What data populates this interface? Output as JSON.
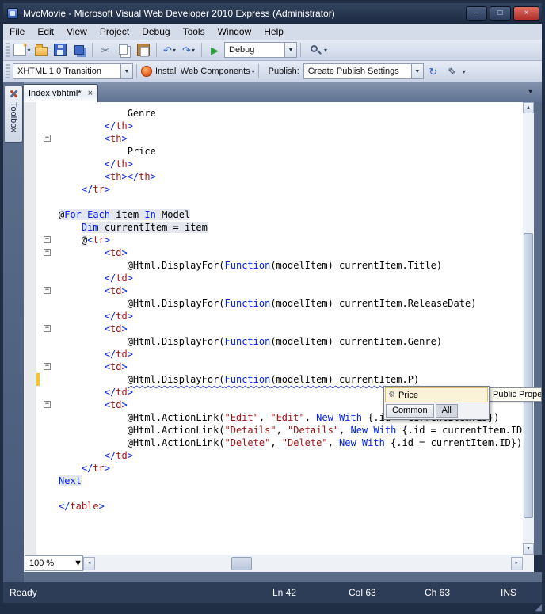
{
  "window": {
    "title": "MvcMovie - Microsoft Visual Web Developer 2010 Express (Administrator)"
  },
  "icons": {
    "minimize": "–",
    "maximize": "□",
    "close": "×",
    "dropdown": "▾",
    "combo_arrow": "▼",
    "cut": "✂",
    "undo": "↶",
    "redo": "↷",
    "play": "▶",
    "refresh": "↻",
    "pencil": "✎",
    "tab_close": "×",
    "tablist": "▼",
    "up": "▲",
    "down": "▼",
    "left": "◄",
    "right": "►",
    "property": "⚙",
    "grip": "◢",
    "fold_collapse": "−"
  },
  "menu": {
    "items": [
      "File",
      "Edit",
      "View",
      "Project",
      "Debug",
      "Tools",
      "Window",
      "Help"
    ]
  },
  "toolbar1": {
    "debug_combo": "Debug"
  },
  "toolbar2": {
    "schema_combo": "XHTML 1.0 Transition",
    "install_label": "Install Web Components",
    "publish_label": "Publish:",
    "publish_combo": "Create Publish Settings"
  },
  "tabs": {
    "active": "Index.vbhtml*"
  },
  "toolbox": {
    "label": "Toolbox"
  },
  "editor": {
    "fold_lines": [
      3,
      11,
      12,
      15,
      18,
      21,
      24
    ],
    "changed_lines": [
      22
    ],
    "lines": [
      [
        {
          "t": "            Genre"
        }
      ],
      [
        {
          "t": "        "
        },
        {
          "t": "</",
          "c": "k"
        },
        {
          "t": "th",
          "c": "m"
        },
        {
          "t": ">",
          "c": "k"
        }
      ],
      [
        {
          "t": "        "
        },
        {
          "t": "<",
          "c": "k"
        },
        {
          "t": "th",
          "c": "m"
        },
        {
          "t": ">",
          "c": "k"
        }
      ],
      [
        {
          "t": "            Price"
        }
      ],
      [
        {
          "t": "        "
        },
        {
          "t": "</",
          "c": "k"
        },
        {
          "t": "th",
          "c": "m"
        },
        {
          "t": ">",
          "c": "k"
        }
      ],
      [
        {
          "t": "        "
        },
        {
          "t": "<",
          "c": "k"
        },
        {
          "t": "th",
          "c": "m"
        },
        {
          "t": ">",
          "c": "k"
        },
        {
          "t": "</",
          "c": "k"
        },
        {
          "t": "th",
          "c": "m"
        },
        {
          "t": ">",
          "c": "k"
        }
      ],
      [
        {
          "t": "    "
        },
        {
          "t": "</",
          "c": "k"
        },
        {
          "t": "tr",
          "c": "m"
        },
        {
          "t": ">",
          "c": "k"
        }
      ],
      [],
      [
        {
          "t": "@",
          "bg": 1
        },
        {
          "t": "For Each",
          "c": "k",
          "bg": 1
        },
        {
          "t": " item ",
          "bg": 1
        },
        {
          "t": "In",
          "c": "k",
          "bg": 1
        },
        {
          "t": " Model",
          "bg": 1
        }
      ],
      [
        {
          "t": "    "
        },
        {
          "t": "Dim",
          "c": "k",
          "bg": 1
        },
        {
          "t": " currentItem = item",
          "bg": 1
        }
      ],
      [
        {
          "t": "    "
        },
        {
          "t": "@",
          "bg": 1
        },
        {
          "t": "<",
          "c": "k"
        },
        {
          "t": "tr",
          "c": "m"
        },
        {
          "t": ">",
          "c": "k"
        }
      ],
      [
        {
          "t": "        "
        },
        {
          "t": "<",
          "c": "k"
        },
        {
          "t": "td",
          "c": "m"
        },
        {
          "t": ">",
          "c": "k"
        }
      ],
      [
        {
          "t": "            "
        },
        {
          "t": "@Html.DisplayFor("
        },
        {
          "t": "Function",
          "c": "k"
        },
        {
          "t": "(modelItem) currentItem.Title)"
        }
      ],
      [
        {
          "t": "        "
        },
        {
          "t": "</",
          "c": "k"
        },
        {
          "t": "td",
          "c": "m"
        },
        {
          "t": ">",
          "c": "k"
        }
      ],
      [
        {
          "t": "        "
        },
        {
          "t": "<",
          "c": "k"
        },
        {
          "t": "td",
          "c": "m"
        },
        {
          "t": ">",
          "c": "k"
        }
      ],
      [
        {
          "t": "            "
        },
        {
          "t": "@Html.DisplayFor("
        },
        {
          "t": "Function",
          "c": "k"
        },
        {
          "t": "(modelItem) currentItem.ReleaseDate)"
        }
      ],
      [
        {
          "t": "        "
        },
        {
          "t": "</",
          "c": "k"
        },
        {
          "t": "td",
          "c": "m"
        },
        {
          "t": ">",
          "c": "k"
        }
      ],
      [
        {
          "t": "        "
        },
        {
          "t": "<",
          "c": "k"
        },
        {
          "t": "td",
          "c": "m"
        },
        {
          "t": ">",
          "c": "k"
        }
      ],
      [
        {
          "t": "            "
        },
        {
          "t": "@Html.DisplayFor("
        },
        {
          "t": "Function",
          "c": "k"
        },
        {
          "t": "(modelItem) currentItem.Genre)"
        }
      ],
      [
        {
          "t": "        "
        },
        {
          "t": "</",
          "c": "k"
        },
        {
          "t": "td",
          "c": "m"
        },
        {
          "t": ">",
          "c": "k"
        }
      ],
      [
        {
          "t": "        "
        },
        {
          "t": "<",
          "c": "k"
        },
        {
          "t": "td",
          "c": "m"
        },
        {
          "t": ">",
          "c": "k"
        }
      ],
      [
        {
          "t": "            "
        },
        {
          "t": "@Html.DisplayFor(",
          "sq": 1
        },
        {
          "t": "Function",
          "c": "k",
          "sq": 1
        },
        {
          "t": "(modelItem) currentItem.P)",
          "sq": 1
        }
      ],
      [
        {
          "t": "        "
        },
        {
          "t": "</",
          "c": "k"
        },
        {
          "t": "td",
          "c": "m"
        },
        {
          "t": ">",
          "c": "k"
        }
      ],
      [
        {
          "t": "        "
        },
        {
          "t": "<",
          "c": "k"
        },
        {
          "t": "td",
          "c": "m"
        },
        {
          "t": ">",
          "c": "k"
        }
      ],
      [
        {
          "t": "            "
        },
        {
          "t": "@Html.ActionLink("
        },
        {
          "t": "\"Edit\"",
          "c": "s"
        },
        {
          "t": ", "
        },
        {
          "t": "\"Edit\"",
          "c": "s"
        },
        {
          "t": ", "
        },
        {
          "t": "New With",
          "c": "k"
        },
        {
          "t": " {.id = currentItem.ID})"
        }
      ],
      [
        {
          "t": "            "
        },
        {
          "t": "@Html.ActionLink("
        },
        {
          "t": "\"Details\"",
          "c": "s"
        },
        {
          "t": ", "
        },
        {
          "t": "\"Details\"",
          "c": "s"
        },
        {
          "t": ", "
        },
        {
          "t": "New With",
          "c": "k"
        },
        {
          "t": " {.id = currentItem.ID})"
        }
      ],
      [
        {
          "t": "            "
        },
        {
          "t": "@Html.ActionLink("
        },
        {
          "t": "\"Delete\"",
          "c": "s"
        },
        {
          "t": ", "
        },
        {
          "t": "\"Delete\"",
          "c": "s"
        },
        {
          "t": ", "
        },
        {
          "t": "New With",
          "c": "k"
        },
        {
          "t": " {.id = currentItem.ID})"
        }
      ],
      [
        {
          "t": "        "
        },
        {
          "t": "</",
          "c": "k"
        },
        {
          "t": "td",
          "c": "m"
        },
        {
          "t": ">",
          "c": "k"
        }
      ],
      [
        {
          "t": "    "
        },
        {
          "t": "</",
          "c": "k"
        },
        {
          "t": "tr",
          "c": "m"
        },
        {
          "t": ">",
          "c": "k"
        }
      ],
      [
        {
          "t": "Next",
          "c": "k",
          "bg": 1
        }
      ],
      [],
      [
        {
          "t": "</",
          "c": "k"
        },
        {
          "t": "table",
          "c": "m"
        },
        {
          "t": ">",
          "c": "k"
        }
      ]
    ]
  },
  "intellisense": {
    "selected_item": "Price",
    "tabs": [
      "Common",
      "All"
    ],
    "tooltip": "Public Prope"
  },
  "zoom": {
    "value": "100 %"
  },
  "status": {
    "ready": "Ready",
    "line": "Ln 42",
    "column": "Col 63",
    "character": "Ch 63",
    "insert_mode": "INS"
  }
}
